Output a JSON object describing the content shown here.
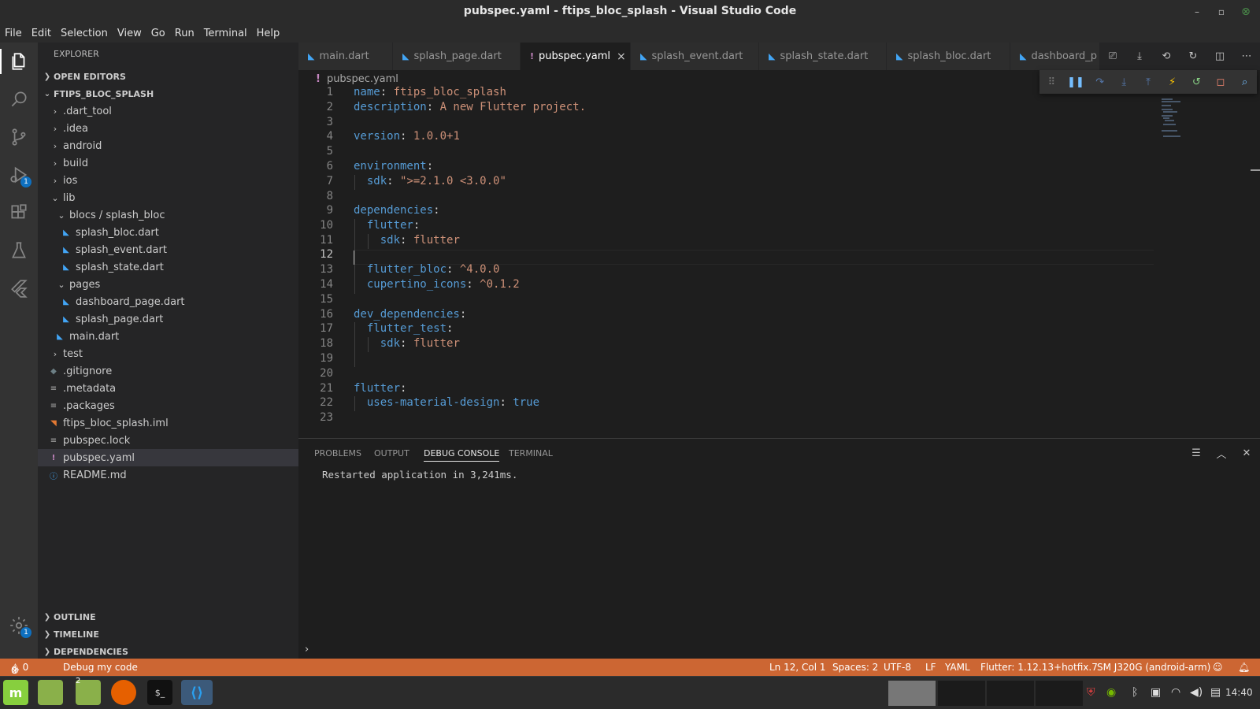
{
  "window": {
    "title": "pubspec.yaml - ftips_bloc_splash - Visual Studio Code"
  },
  "menu": [
    "File",
    "Edit",
    "Selection",
    "View",
    "Go",
    "Run",
    "Terminal",
    "Help"
  ],
  "activity": {
    "debug_badge": "1",
    "settings_badge": "1"
  },
  "sidebar": {
    "header": "EXPLORER",
    "open_editors": "OPEN EDITORS",
    "project": "FTIPS_BLOC_SPLASH",
    "tree": [
      {
        "label": ".dart_tool"
      },
      {
        "label": ".idea"
      },
      {
        "label": "android"
      },
      {
        "label": "build"
      },
      {
        "label": "ios"
      },
      {
        "label": "lib"
      },
      {
        "label": "blocs / splash_bloc"
      },
      {
        "label": "splash_bloc.dart"
      },
      {
        "label": "splash_event.dart"
      },
      {
        "label": "splash_state.dart"
      },
      {
        "label": "pages"
      },
      {
        "label": "dashboard_page.dart"
      },
      {
        "label": "splash_page.dart"
      },
      {
        "label": "main.dart"
      },
      {
        "label": "test"
      },
      {
        "label": ".gitignore"
      },
      {
        "label": ".metadata"
      },
      {
        "label": ".packages"
      },
      {
        "label": "ftips_bloc_splash.iml"
      },
      {
        "label": "pubspec.lock"
      },
      {
        "label": "pubspec.yaml"
      },
      {
        "label": "README.md"
      }
    ],
    "outline": "OUTLINE",
    "timeline": "TIMELINE",
    "dependencies": "DEPENDENCIES"
  },
  "tabs": [
    {
      "label": "main.dart"
    },
    {
      "label": "splash_page.dart"
    },
    {
      "label": "pubspec.yaml"
    },
    {
      "label": "splash_event.dart"
    },
    {
      "label": "splash_state.dart"
    },
    {
      "label": "splash_bloc.dart"
    },
    {
      "label": "dashboard_p"
    }
  ],
  "breadcrumb": "pubspec.yaml",
  "code": {
    "line_numbers": [
      "1",
      "2",
      "3",
      "4",
      "5",
      "6",
      "7",
      "8",
      "9",
      "10",
      "11",
      "12",
      "13",
      "14",
      "15",
      "16",
      "17",
      "18",
      "19",
      "20",
      "21",
      "22",
      "23"
    ],
    "l1": {
      "k": "name",
      "v": "ftips_bloc_splash"
    },
    "l2": {
      "k": "description",
      "v": "A new Flutter project."
    },
    "l4": {
      "k": "version",
      "v": "1.0.0+1"
    },
    "l6": {
      "k": "environment"
    },
    "l7": {
      "k": "sdk",
      "v": "\">=2.1.0 <3.0.0\""
    },
    "l9": {
      "k": "dependencies"
    },
    "l10": {
      "k": "flutter"
    },
    "l11": {
      "k": "sdk",
      "v": "flutter"
    },
    "l13": {
      "k": "flutter_bloc",
      "v": "^4.0.0"
    },
    "l14": {
      "k": "cupertino_icons",
      "v": "^0.1.2"
    },
    "l16": {
      "k": "dev_dependencies"
    },
    "l17": {
      "k": "flutter_test"
    },
    "l18": {
      "k": "sdk",
      "v": "flutter"
    },
    "l21": {
      "k": "flutter"
    },
    "l22": {
      "k": "uses-material-design",
      "v": "true"
    }
  },
  "panel": {
    "tabs": [
      "PROBLEMS",
      "OUTPUT",
      "DEBUG CONSOLE",
      "TERMINAL"
    ],
    "output": "Restarted application in 3,241ms.",
    "prompt": "›"
  },
  "status": {
    "errors": "0",
    "warnings": "0",
    "debug": "Debug my code",
    "position": "Ln 12, Col 1",
    "spaces": "Spaces: 2",
    "encoding": "UTF-8",
    "eol": "LF",
    "language": "YAML",
    "flutter": "Flutter: 1.12.13+hotfix.7",
    "device": "SM J320G (android-arm)"
  },
  "taskbar": {
    "files_count": "2",
    "clock": "14:40"
  },
  "colors": {
    "status_bar": "#cc6633",
    "accent": "#0e70c0",
    "dart_icon": "#42a5f5"
  }
}
